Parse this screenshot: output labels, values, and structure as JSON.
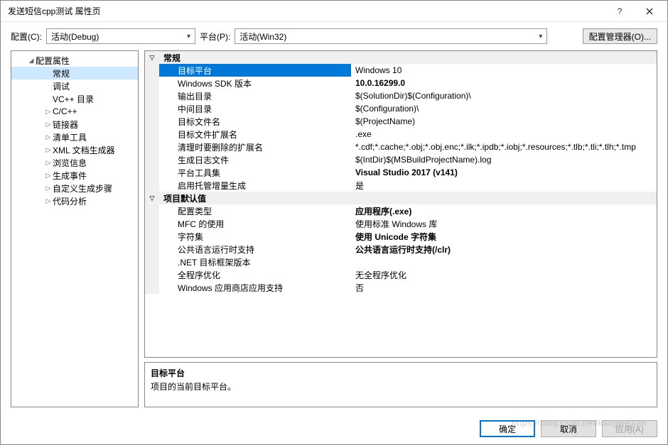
{
  "window": {
    "title": "发送短信cpp测试 属性页"
  },
  "toolbar": {
    "config_label": "配置(C):",
    "config_value": "活动(Debug)",
    "platform_label": "平台(P):",
    "platform_value": "活动(Win32)",
    "manager_label": "配置管理器(O)..."
  },
  "tree": {
    "root": "配置属性",
    "items": [
      {
        "label": "常规",
        "selected": true
      },
      {
        "label": "调试"
      },
      {
        "label": "VC++ 目录"
      },
      {
        "label": "C/C++",
        "expandable": true
      },
      {
        "label": "链接器",
        "expandable": true
      },
      {
        "label": "清单工具",
        "expandable": true
      },
      {
        "label": "XML 文档生成器",
        "expandable": true
      },
      {
        "label": "浏览信息",
        "expandable": true
      },
      {
        "label": "生成事件",
        "expandable": true
      },
      {
        "label": "自定义生成步骤",
        "expandable": true
      },
      {
        "label": "代码分析",
        "expandable": true
      }
    ]
  },
  "grid": {
    "cat1": "常规",
    "cat2": "项目默认值",
    "g1": [
      {
        "k": "目标平台",
        "v": "Windows 10",
        "selected": true
      },
      {
        "k": "Windows SDK 版本",
        "v": "10.0.16299.0",
        "bold": true
      },
      {
        "k": "输出目录",
        "v": "$(SolutionDir)$(Configuration)\\"
      },
      {
        "k": "中间目录",
        "v": "$(Configuration)\\"
      },
      {
        "k": "目标文件名",
        "v": "$(ProjectName)"
      },
      {
        "k": "目标文件扩展名",
        "v": ".exe"
      },
      {
        "k": "清理时要删除的扩展名",
        "v": "*.cdf;*.cache;*.obj;*.obj.enc;*.ilk;*.ipdb;*.iobj;*.resources;*.tlb;*.tli;*.tlh;*.tmp"
      },
      {
        "k": "生成日志文件",
        "v": "$(IntDir)$(MSBuildProjectName).log"
      },
      {
        "k": "平台工具集",
        "v": "Visual Studio 2017 (v141)",
        "bold": true
      },
      {
        "k": "启用托管增量生成",
        "v": "是"
      }
    ],
    "g2": [
      {
        "k": "配置类型",
        "v": "应用程序(.exe)",
        "bold": true
      },
      {
        "k": "MFC 的使用",
        "v": "使用标准 Windows 库"
      },
      {
        "k": "字符集",
        "v": "使用 Unicode 字符集",
        "bold": true
      },
      {
        "k": "公共语言运行时支持",
        "v": "公共语言运行时支持(/clr)",
        "bold": true
      },
      {
        "k": ".NET 目标框架版本",
        "v": ""
      },
      {
        "k": "全程序优化",
        "v": "无全程序优化"
      },
      {
        "k": "Windows 应用商店应用支持",
        "v": "否"
      }
    ]
  },
  "desc": {
    "title": "目标平台",
    "text": "项目的当前目标平台。"
  },
  "buttons": {
    "ok": "确定",
    "cancel": "取消",
    "apply": "应用(A)"
  },
  "watermark": "https://blog.csdn.net/kangweijian"
}
